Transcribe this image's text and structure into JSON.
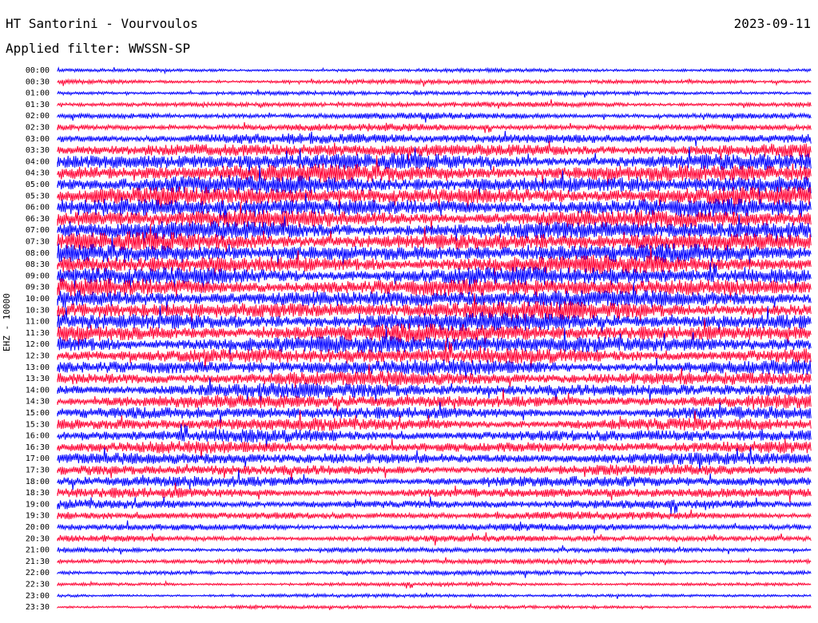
{
  "header": {
    "station": "HT Santorini - Vourvoulos",
    "date": "2023-09-11",
    "filter": "Applied filter: WWSSN-SP"
  },
  "channel": "EHZ - 10000",
  "colors": {
    "trace_a": "#0000ff",
    "trace_b": "#ff0033",
    "background": "#ffffff"
  },
  "chart_data": {
    "type": "helicorder",
    "title": "HT Santorini - Vourvoulos",
    "ylabel": "EHZ - 10000",
    "row_labels": [
      "00:00",
      "00:30",
      "01:00",
      "01:30",
      "02:00",
      "02:30",
      "03:00",
      "03:30",
      "04:00",
      "04:30",
      "05:00",
      "05:30",
      "06:00",
      "06:30",
      "07:00",
      "07:30",
      "08:00",
      "08:30",
      "09:00",
      "09:30",
      "10:00",
      "10:30",
      "11:00",
      "11:30",
      "12:00",
      "12:30",
      "13:00",
      "13:30",
      "14:00",
      "14:30",
      "15:00",
      "15:30",
      "16:00",
      "16:30",
      "17:00",
      "17:30",
      "18:00",
      "18:30",
      "19:00",
      "19:30",
      "20:00",
      "20:30",
      "21:00",
      "21:30",
      "22:00",
      "22:30",
      "23:00",
      "23:30"
    ],
    "amplitude": [
      0.2,
      0.25,
      0.25,
      0.3,
      0.35,
      0.4,
      0.6,
      0.75,
      0.9,
      1.0,
      1.0,
      1.0,
      1.0,
      1.0,
      1.0,
      1.0,
      1.0,
      1.0,
      1.0,
      1.0,
      1.0,
      1.0,
      1.0,
      1.0,
      1.0,
      0.9,
      0.85,
      0.8,
      0.8,
      0.75,
      0.7,
      0.7,
      0.7,
      0.65,
      0.65,
      0.6,
      0.6,
      0.55,
      0.5,
      0.45,
      0.4,
      0.35,
      0.3,
      0.3,
      0.25,
      0.2,
      0.2,
      0.2
    ],
    "row_colors": [
      "blue",
      "red"
    ],
    "grid": false
  }
}
